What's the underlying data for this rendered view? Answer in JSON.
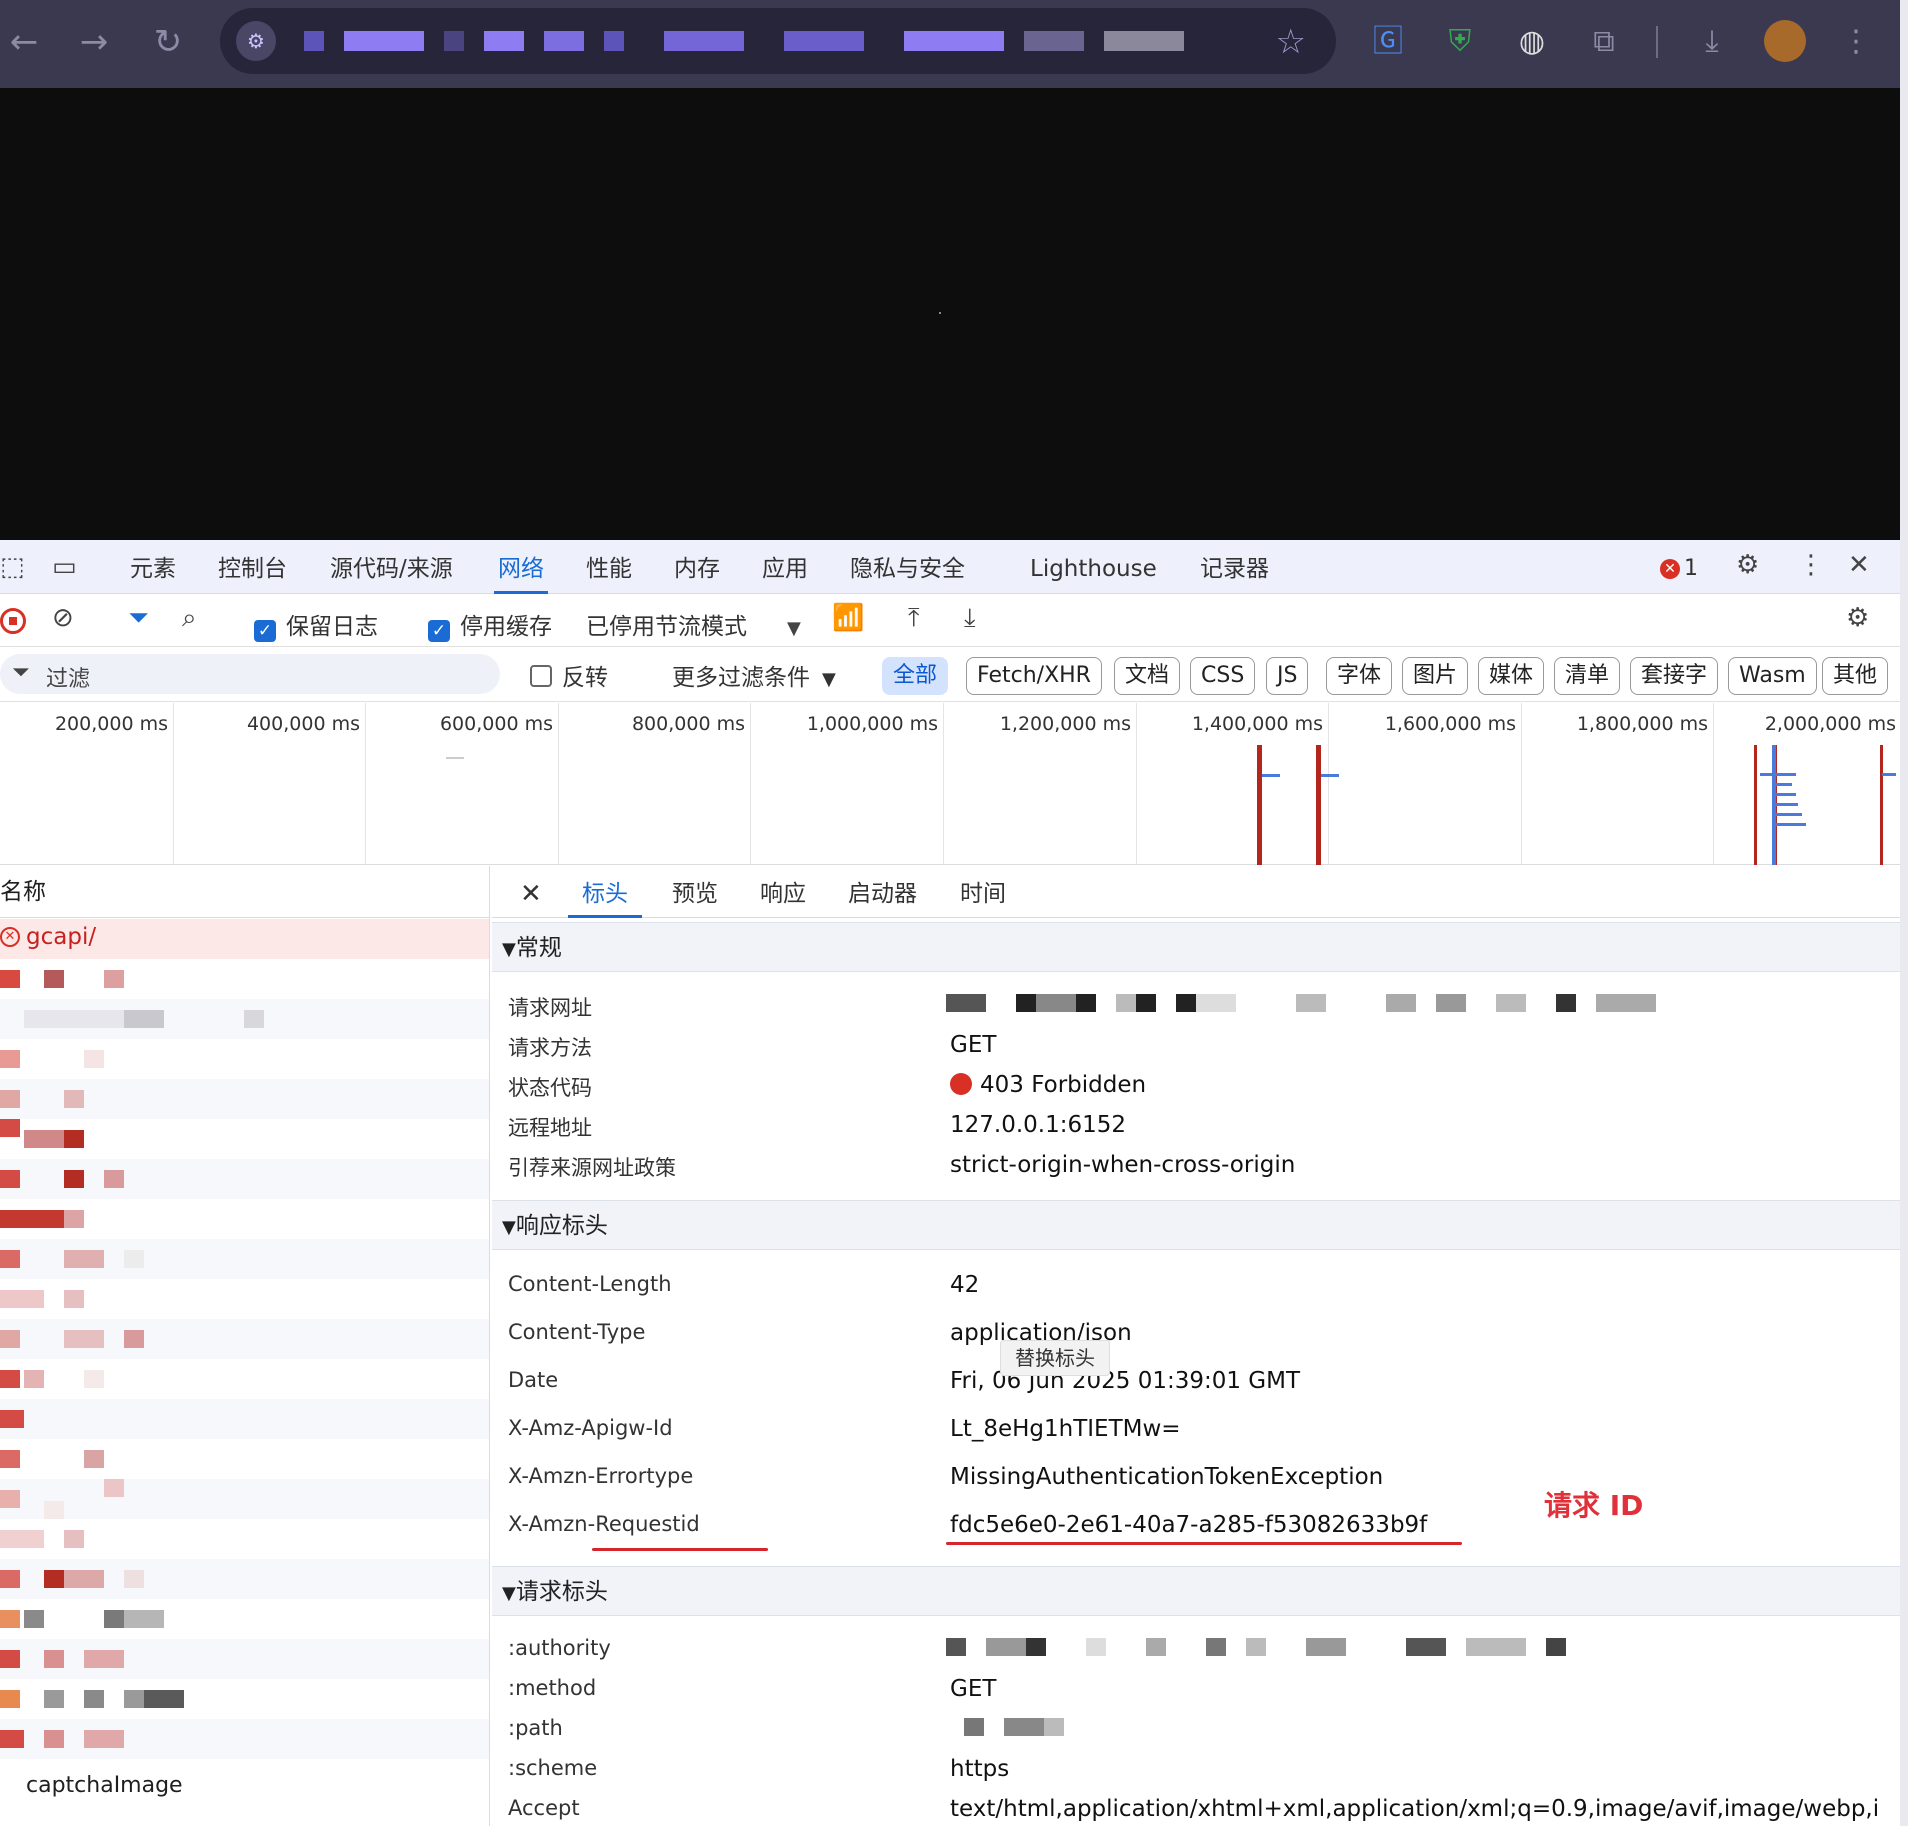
{
  "devtools": {
    "tabs": [
      "元素",
      "控制台",
      "源代码/来源",
      "网络",
      "性能",
      "内存",
      "应用",
      "隐私与安全",
      "Lighthouse",
      "记录器"
    ],
    "active_tab": "网络",
    "error_count": "1",
    "toolbar": {
      "preserve_log": "保留日志",
      "disable_cache": "停用缓存",
      "throttling": "已停用节流模式"
    },
    "filter": {
      "placeholder": "过滤",
      "invert": "反转",
      "more_filters": "更多过滤条件",
      "types": [
        "全部",
        "Fetch/XHR",
        "文档",
        "CSS",
        "JS",
        "字体",
        "图片",
        "媒体",
        "清单",
        "套接字",
        "Wasm",
        "其他"
      ],
      "active_type": "全部"
    },
    "timeline": {
      "ticks": [
        "200,000 ms",
        "400,000 ms",
        "600,000 ms",
        "800,000 ms",
        "1,000,000 ms",
        "1,200,000 ms",
        "1,400,000 ms",
        "1,600,000 ms",
        "1,800,000 ms",
        "2,000,000 ms"
      ]
    },
    "request_list": {
      "header": "名称",
      "selected": "gcapi/",
      "last_visible": "captchaImage"
    },
    "details": {
      "tabs": [
        "标头",
        "预览",
        "响应",
        "启动器",
        "时间"
      ],
      "active_tab": "标头",
      "general": {
        "title": "常规",
        "rows": [
          {
            "key": "请求网址",
            "value": ""
          },
          {
            "key": "请求方法",
            "value": "GET"
          },
          {
            "key": "状态代码",
            "value": "403 Forbidden"
          },
          {
            "key": "远程地址",
            "value": "127.0.0.1:6152"
          },
          {
            "key": "引荐来源网址政策",
            "value": "strict-origin-when-cross-origin"
          }
        ]
      },
      "response_headers": {
        "title": "响应标头",
        "rows": [
          {
            "key": "Content-Length",
            "value": "42"
          },
          {
            "key": "Content-Type",
            "value": "application/json"
          },
          {
            "key": "Date",
            "value": "Fri, 06 Jun 2025 01:39:01 GMT"
          },
          {
            "key": "X-Amz-Apigw-Id",
            "value": "Lt_8eHg1hTIETMw="
          },
          {
            "key": "X-Amzn-Errortype",
            "value": "MissingAuthenticationTokenException"
          },
          {
            "key": "X-Amzn-Requestid",
            "value": "fdc5e6e0-2e61-40a7-a285-f53082633b9f"
          }
        ]
      },
      "tooltip": "替换标头",
      "annotation": "请求 ID",
      "request_headers": {
        "title": "请求标头",
        "rows": [
          {
            "key": ":authority",
            "value": ""
          },
          {
            "key": ":method",
            "value": "GET"
          },
          {
            "key": ":path",
            "value": ""
          },
          {
            "key": ":scheme",
            "value": "https"
          },
          {
            "key": "Accept",
            "value": "text/html,application/xhtml+xml,application/xml;q=0.9,image/avif,image/webp,ima"
          }
        ]
      }
    }
  },
  "colors": {
    "accent": "#1a6cd4",
    "error": "#d93025",
    "annotation": "#e0303a"
  }
}
